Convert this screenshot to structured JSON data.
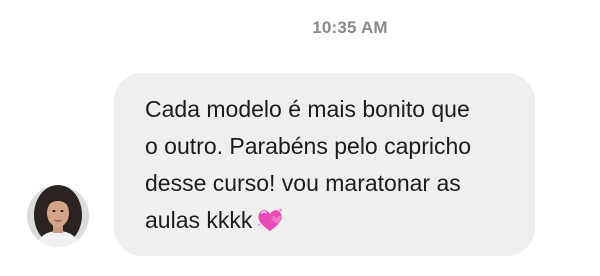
{
  "timestamp": "10:35 AM",
  "message": {
    "lines": [
      "Cada modelo é mais bonito que",
      "o outro. Parabéns pelo capricho",
      "desse curso! vou maratonar as",
      "aulas kkkk"
    ],
    "emoji": "two-hearts-emoji"
  },
  "colors": {
    "bubble": "#efefef",
    "text": "#1c1c1c",
    "timestamp": "#8a8a8e",
    "heart": "#e64bb7"
  }
}
